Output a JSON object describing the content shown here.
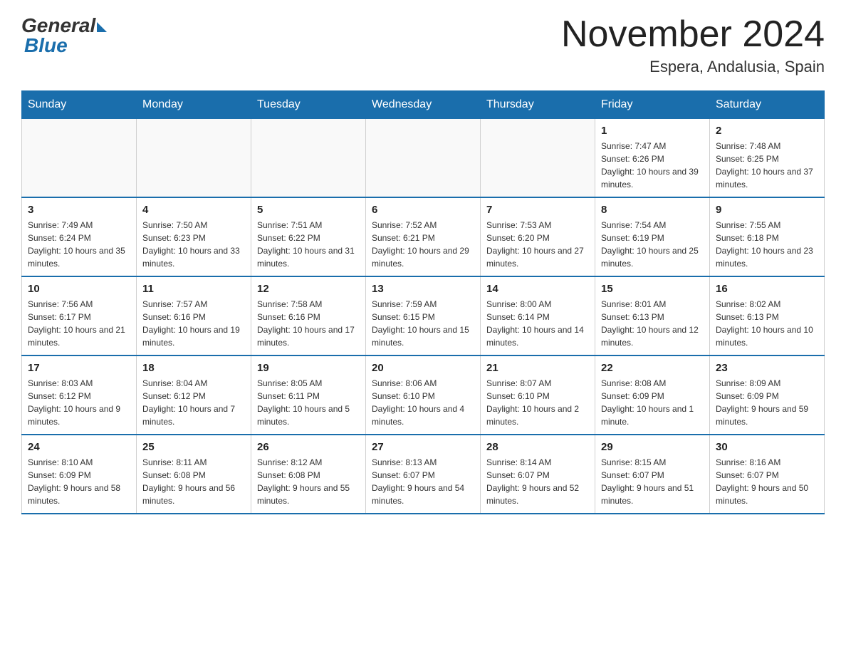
{
  "header": {
    "logo_general": "General",
    "logo_blue": "Blue",
    "month_title": "November 2024",
    "location": "Espera, Andalusia, Spain"
  },
  "weekdays": [
    "Sunday",
    "Monday",
    "Tuesday",
    "Wednesday",
    "Thursday",
    "Friday",
    "Saturday"
  ],
  "weeks": [
    [
      {
        "day": "",
        "info": ""
      },
      {
        "day": "",
        "info": ""
      },
      {
        "day": "",
        "info": ""
      },
      {
        "day": "",
        "info": ""
      },
      {
        "day": "",
        "info": ""
      },
      {
        "day": "1",
        "info": "Sunrise: 7:47 AM\nSunset: 6:26 PM\nDaylight: 10 hours and 39 minutes."
      },
      {
        "day": "2",
        "info": "Sunrise: 7:48 AM\nSunset: 6:25 PM\nDaylight: 10 hours and 37 minutes."
      }
    ],
    [
      {
        "day": "3",
        "info": "Sunrise: 7:49 AM\nSunset: 6:24 PM\nDaylight: 10 hours and 35 minutes."
      },
      {
        "day": "4",
        "info": "Sunrise: 7:50 AM\nSunset: 6:23 PM\nDaylight: 10 hours and 33 minutes."
      },
      {
        "day": "5",
        "info": "Sunrise: 7:51 AM\nSunset: 6:22 PM\nDaylight: 10 hours and 31 minutes."
      },
      {
        "day": "6",
        "info": "Sunrise: 7:52 AM\nSunset: 6:21 PM\nDaylight: 10 hours and 29 minutes."
      },
      {
        "day": "7",
        "info": "Sunrise: 7:53 AM\nSunset: 6:20 PM\nDaylight: 10 hours and 27 minutes."
      },
      {
        "day": "8",
        "info": "Sunrise: 7:54 AM\nSunset: 6:19 PM\nDaylight: 10 hours and 25 minutes."
      },
      {
        "day": "9",
        "info": "Sunrise: 7:55 AM\nSunset: 6:18 PM\nDaylight: 10 hours and 23 minutes."
      }
    ],
    [
      {
        "day": "10",
        "info": "Sunrise: 7:56 AM\nSunset: 6:17 PM\nDaylight: 10 hours and 21 minutes."
      },
      {
        "day": "11",
        "info": "Sunrise: 7:57 AM\nSunset: 6:16 PM\nDaylight: 10 hours and 19 minutes."
      },
      {
        "day": "12",
        "info": "Sunrise: 7:58 AM\nSunset: 6:16 PM\nDaylight: 10 hours and 17 minutes."
      },
      {
        "day": "13",
        "info": "Sunrise: 7:59 AM\nSunset: 6:15 PM\nDaylight: 10 hours and 15 minutes."
      },
      {
        "day": "14",
        "info": "Sunrise: 8:00 AM\nSunset: 6:14 PM\nDaylight: 10 hours and 14 minutes."
      },
      {
        "day": "15",
        "info": "Sunrise: 8:01 AM\nSunset: 6:13 PM\nDaylight: 10 hours and 12 minutes."
      },
      {
        "day": "16",
        "info": "Sunrise: 8:02 AM\nSunset: 6:13 PM\nDaylight: 10 hours and 10 minutes."
      }
    ],
    [
      {
        "day": "17",
        "info": "Sunrise: 8:03 AM\nSunset: 6:12 PM\nDaylight: 10 hours and 9 minutes."
      },
      {
        "day": "18",
        "info": "Sunrise: 8:04 AM\nSunset: 6:12 PM\nDaylight: 10 hours and 7 minutes."
      },
      {
        "day": "19",
        "info": "Sunrise: 8:05 AM\nSunset: 6:11 PM\nDaylight: 10 hours and 5 minutes."
      },
      {
        "day": "20",
        "info": "Sunrise: 8:06 AM\nSunset: 6:10 PM\nDaylight: 10 hours and 4 minutes."
      },
      {
        "day": "21",
        "info": "Sunrise: 8:07 AM\nSunset: 6:10 PM\nDaylight: 10 hours and 2 minutes."
      },
      {
        "day": "22",
        "info": "Sunrise: 8:08 AM\nSunset: 6:09 PM\nDaylight: 10 hours and 1 minute."
      },
      {
        "day": "23",
        "info": "Sunrise: 8:09 AM\nSunset: 6:09 PM\nDaylight: 9 hours and 59 minutes."
      }
    ],
    [
      {
        "day": "24",
        "info": "Sunrise: 8:10 AM\nSunset: 6:09 PM\nDaylight: 9 hours and 58 minutes."
      },
      {
        "day": "25",
        "info": "Sunrise: 8:11 AM\nSunset: 6:08 PM\nDaylight: 9 hours and 56 minutes."
      },
      {
        "day": "26",
        "info": "Sunrise: 8:12 AM\nSunset: 6:08 PM\nDaylight: 9 hours and 55 minutes."
      },
      {
        "day": "27",
        "info": "Sunrise: 8:13 AM\nSunset: 6:07 PM\nDaylight: 9 hours and 54 minutes."
      },
      {
        "day": "28",
        "info": "Sunrise: 8:14 AM\nSunset: 6:07 PM\nDaylight: 9 hours and 52 minutes."
      },
      {
        "day": "29",
        "info": "Sunrise: 8:15 AM\nSunset: 6:07 PM\nDaylight: 9 hours and 51 minutes."
      },
      {
        "day": "30",
        "info": "Sunrise: 8:16 AM\nSunset: 6:07 PM\nDaylight: 9 hours and 50 minutes."
      }
    ]
  ]
}
